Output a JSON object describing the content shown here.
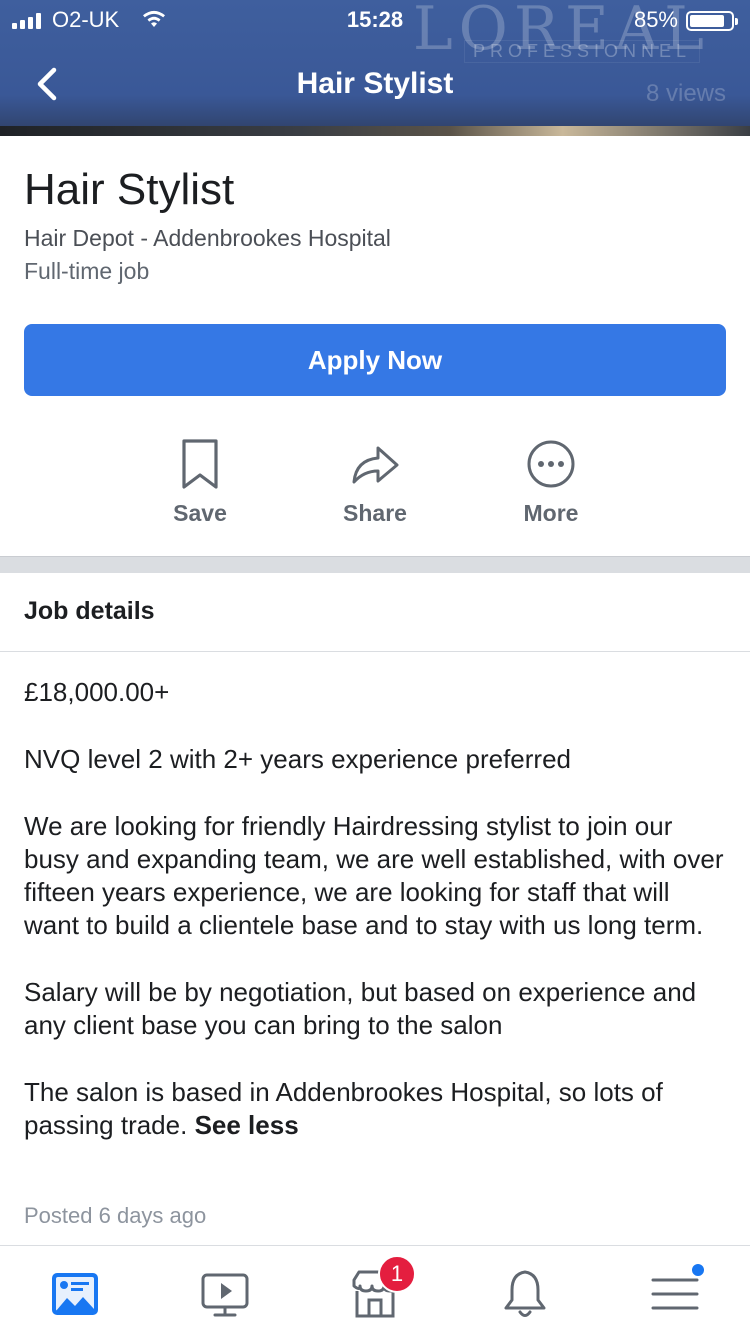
{
  "status_bar": {
    "carrier": "O2-UK",
    "time": "15:28",
    "battery": "85%",
    "battery_level": 0.85
  },
  "header": {
    "title": "Hair Stylist",
    "background_brand": "LOREAL",
    "background_brand_sub": "PROFESSIONNEL",
    "background_views": "8 views",
    "color": "#3b5998"
  },
  "job": {
    "title": "Hair Stylist",
    "company": "Hair Depot - Addenbrookes Hospital",
    "type": "Full-time job",
    "apply_label": "Apply Now",
    "apply_color": "#3578e5"
  },
  "actions": [
    {
      "label": "Save",
      "icon": "bookmark-icon"
    },
    {
      "label": "Share",
      "icon": "share-arrow-icon"
    },
    {
      "label": "More",
      "icon": "more-dots-icon"
    }
  ],
  "details": {
    "section_title": "Job details",
    "salary": "£18,000.00+",
    "requirement": "NVQ level 2 with 2+ years experience preferred",
    "paragraph1": "We are looking for friendly Hairdressing stylist to join our busy and expanding team, we are well established, with over fifteen years experience, we are looking for staff that will want to build a clientele base and to stay with us long term.",
    "paragraph2": "Salary will be by negotiation, but based on experience and any client base you can bring to the salon",
    "paragraph3": "The salon is based in Addenbrookes Hospital, so lots of passing trade.",
    "see_less": "See less",
    "posted": "Posted 6 days ago"
  },
  "tabbar": {
    "tabs": [
      "news-feed-icon",
      "watch-icon",
      "marketplace-icon",
      "notifications-icon",
      "menu-icon"
    ],
    "marketplace_badge": "1",
    "accent": "#1877f2"
  }
}
